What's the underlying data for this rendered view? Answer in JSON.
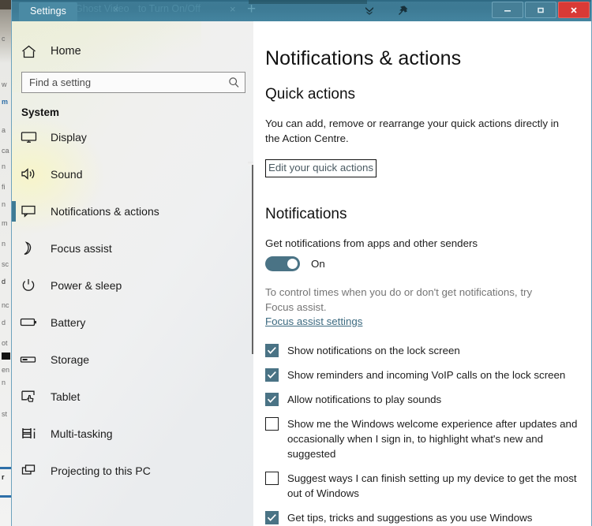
{
  "window": {
    "title": "Settings",
    "ghost_tabs": [
      "Ghost Video",
      "to Turn On/Off"
    ],
    "new_tab_label": "+",
    "controls": {
      "minimize": "Minimize",
      "restore": "Restore",
      "close": "Close"
    },
    "toolbar_icons": [
      "chevron-double-down-icon",
      "pin-icon"
    ]
  },
  "sidebar": {
    "home_label": "Home",
    "search": {
      "placeholder": "Find a setting",
      "value": "",
      "icon": "search-icon"
    },
    "group_title": "System",
    "items": [
      {
        "label": "Display",
        "icon": "monitor-icon",
        "selected": false
      },
      {
        "label": "Sound",
        "icon": "speaker-icon",
        "selected": false
      },
      {
        "label": "Notifications & actions",
        "icon": "comment-icon",
        "selected": true
      },
      {
        "label": "Focus assist",
        "icon": "moon-icon",
        "selected": false
      },
      {
        "label": "Power & sleep",
        "icon": "power-icon",
        "selected": false
      },
      {
        "label": "Battery",
        "icon": "battery-icon",
        "selected": false
      },
      {
        "label": "Storage",
        "icon": "drive-icon",
        "selected": false
      },
      {
        "label": "Tablet",
        "icon": "tablet-touch-icon",
        "selected": false
      },
      {
        "label": "Multi-tasking",
        "icon": "multitask-icon",
        "selected": false
      },
      {
        "label": "Projecting to this PC",
        "icon": "project-icon",
        "selected": false
      }
    ]
  },
  "main": {
    "page_title": "Notifications & actions",
    "quick_actions": {
      "heading": "Quick actions",
      "description": "You can add, remove or rearrange your quick actions directly in the Action Centre.",
      "edit_link": "Edit your quick actions"
    },
    "notifications": {
      "heading": "Notifications",
      "master_label": "Get notifications from apps and other senders",
      "master_state": "On",
      "master_on": true,
      "hint": "To control times when you do or don't get notifications, try Focus assist.",
      "hint_link": "Focus assist settings",
      "checkboxes": [
        {
          "label": "Show notifications on the lock screen",
          "checked": true
        },
        {
          "label": "Show reminders and incoming VoIP calls on the lock screen",
          "checked": true
        },
        {
          "label": "Allow notifications to play sounds",
          "checked": true
        },
        {
          "label": "Show me the Windows welcome experience after updates and occasionally when I sign in, to highlight what's new and suggested",
          "checked": false
        },
        {
          "label": "Suggest ways I can finish setting up my device to get the most out of Windows",
          "checked": false
        },
        {
          "label": "Get tips, tricks and suggestions as you use Windows",
          "checked": true
        }
      ]
    }
  },
  "colors": {
    "titlebar": "#3e7b95",
    "accent_teal": "#4a7385",
    "close_red": "#d93a36",
    "link": "#3c6a80"
  },
  "background_fragments": [
    "c",
    "w",
    "m",
    "a",
    "ca",
    "n",
    "fi",
    "n",
    "m",
    "n",
    "sc",
    "d",
    "nc",
    "d",
    "ot",
    "en",
    "n",
    "st",
    "r"
  ]
}
